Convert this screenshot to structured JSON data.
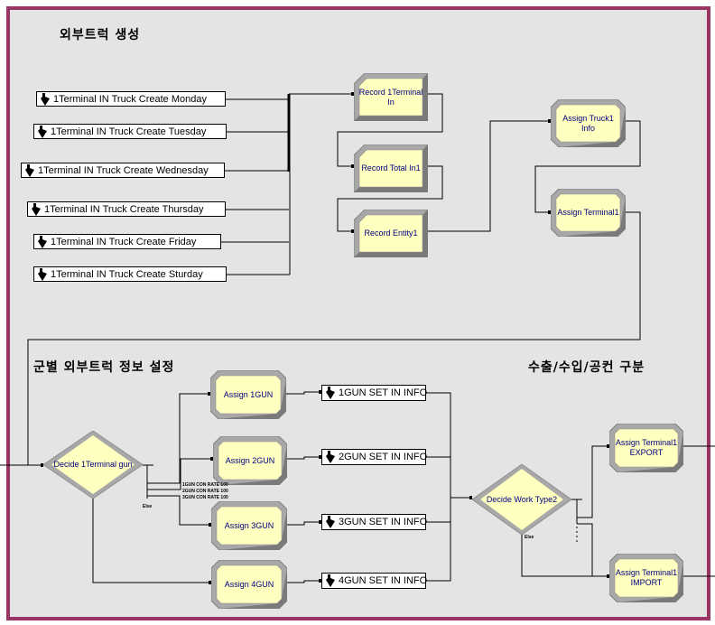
{
  "sections": {
    "truck_generation": "외부트럭 생성",
    "gun_info": "군별 외부트럭 정보 설정",
    "work_type": "수출/수입/공컨 구분"
  },
  "create_modules": [
    {
      "label": "1Terminal IN Truck Create Monday"
    },
    {
      "label": "1Terminal IN Truck Create Tuesday"
    },
    {
      "label": "1Terminal IN Truck Create Wednesday"
    },
    {
      "label": "1Terminal IN Truck Create Thursday"
    },
    {
      "label": "1Terminal IN Truck Create Friday"
    },
    {
      "label": "1Terminal IN Truck Create Sturday"
    }
  ],
  "record_modules": [
    {
      "label": "Record 1Terminal\nIn"
    },
    {
      "label": "Record Total In1"
    },
    {
      "label": "Record Entity1"
    }
  ],
  "assign_modules": {
    "truck_info": "Assign Truck1\nInfo",
    "terminal": "Assign Terminal1",
    "gun1": "Assign 1GUN",
    "gun2": "Assign 2GUN",
    "gun3": "Assign 3GUN",
    "gun4": "Assign 4GUN",
    "export": "Assign Terminal1\nEXPORT",
    "import": "Assign Terminal1\nIMPORT"
  },
  "decide_modules": {
    "terminal_gun": "Decide 1Terminal gun",
    "work_type": "Decide Work Type2"
  },
  "decide_conditions": [
    "1GUN CON RATE 100",
    "2GUN CON RATE 100",
    "3GUN CON RATE 100"
  ],
  "else_label": "Else",
  "gun_set_modules": [
    {
      "label": "1GUN SET IN INFO"
    },
    {
      "label": "2GUN SET IN INFO"
    },
    {
      "label": "3GUN SET IN INFO"
    },
    {
      "label": "4GUN SET IN INFO"
    }
  ],
  "colors": {
    "frame_border": "#9b3565",
    "canvas_bg": "#e4e4e4",
    "module_fill": "#ffffc0",
    "module_text": "#000080"
  }
}
